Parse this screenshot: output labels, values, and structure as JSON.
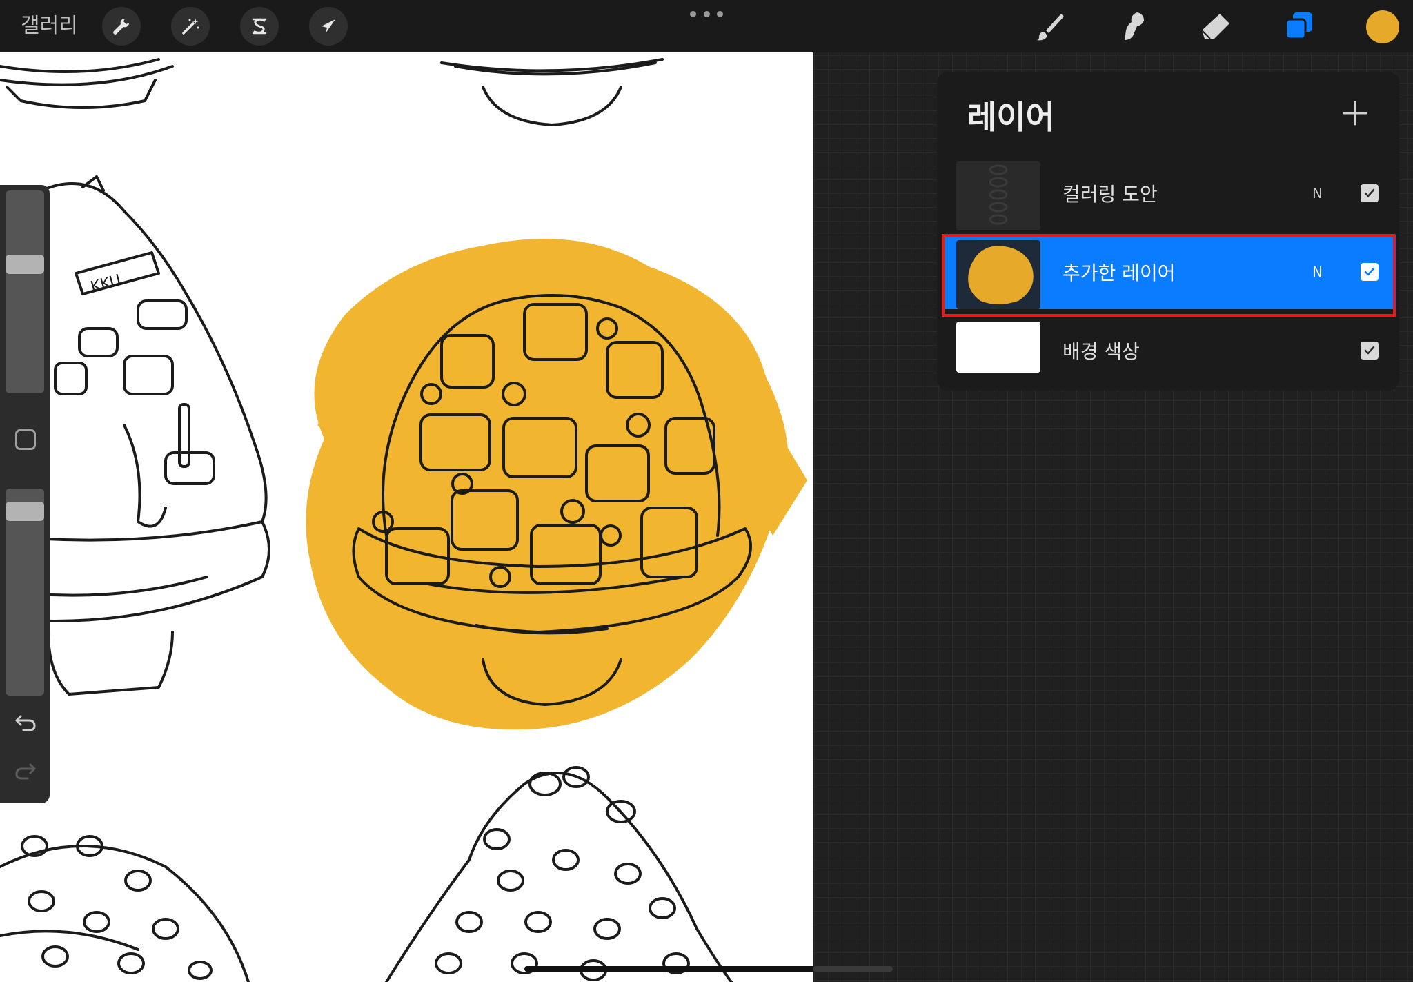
{
  "topbar": {
    "gallery_label": "갤러리",
    "left_tools": [
      {
        "name": "actions",
        "icon": "wrench-icon"
      },
      {
        "name": "adjustments",
        "icon": "magic-wand-icon"
      },
      {
        "name": "selection",
        "icon": "selection-s-icon"
      },
      {
        "name": "transform",
        "icon": "arrow-cursor-icon"
      }
    ],
    "right_tools": [
      {
        "name": "brush",
        "icon": "brush-icon",
        "active": false
      },
      {
        "name": "smudge",
        "icon": "smudge-icon",
        "active": false
      },
      {
        "name": "eraser",
        "icon": "eraser-icon",
        "active": false
      },
      {
        "name": "layers",
        "icon": "layers-icon",
        "active": true
      }
    ],
    "current_color": "#e6a929",
    "accent_color": "#0a7cff"
  },
  "sidebar": {
    "brush_size_level": 0.65,
    "opacity_level": 0.93,
    "modify_button": "square-icon",
    "undo": "undo-icon",
    "redo": "redo-icon"
  },
  "layers_panel": {
    "title": "레이어",
    "add_icon": "plus-icon",
    "layers": [
      {
        "name": "컬러링 도안",
        "blend": "N",
        "visible": true,
        "selected": false
      },
      {
        "name": "추가한 레이어",
        "blend": "N",
        "visible": true,
        "selected": true
      },
      {
        "name": "배경 색상",
        "blend": "",
        "visible": true,
        "selected": false
      }
    ]
  }
}
